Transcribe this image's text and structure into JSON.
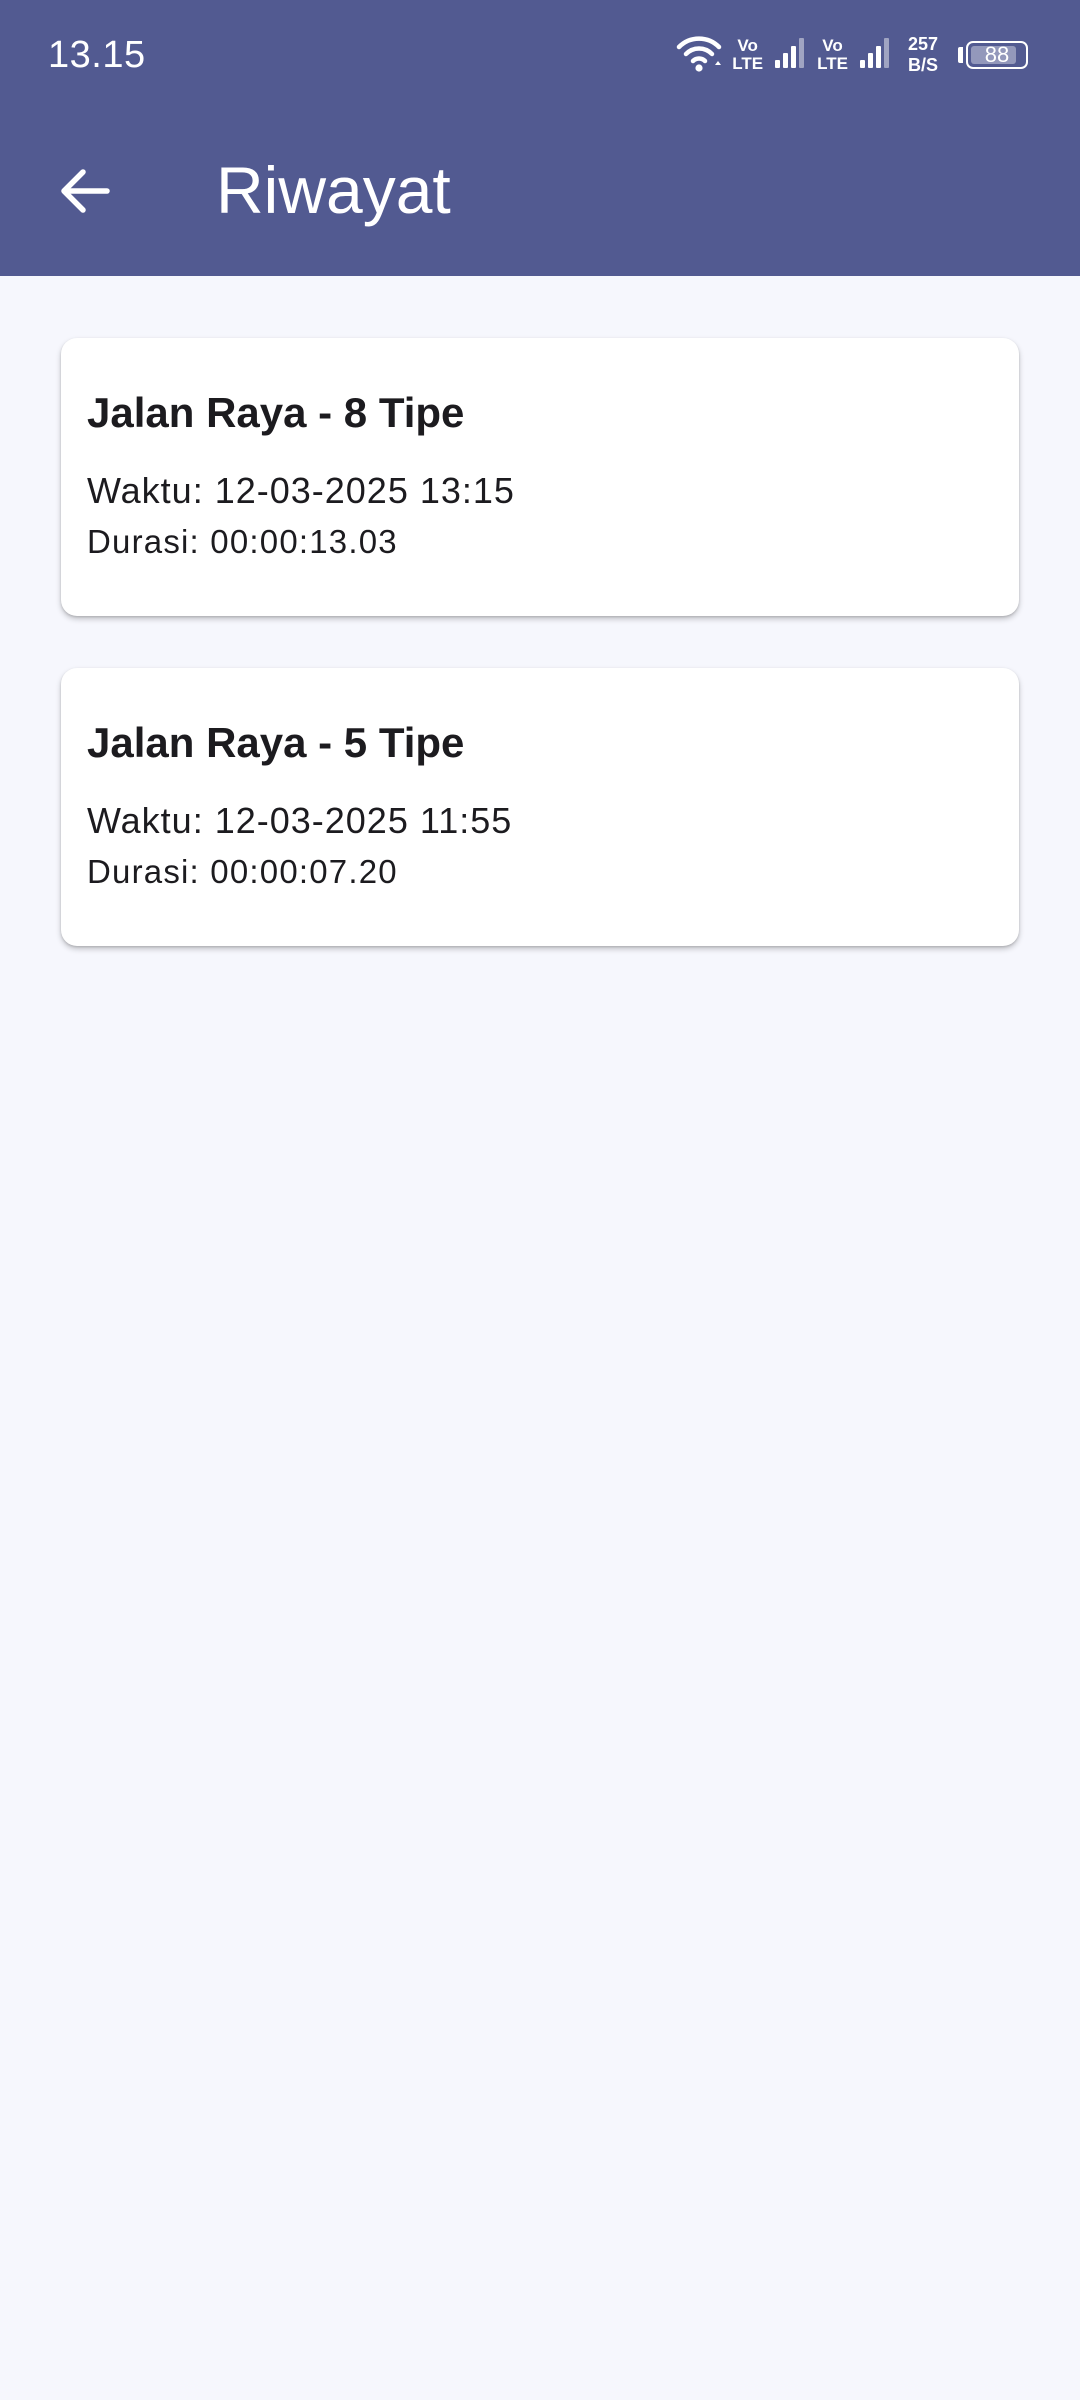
{
  "status_bar": {
    "time": "13.15",
    "volte1_top": "Vo",
    "volte1_bottom": "LTE",
    "volte2_top": "Vo",
    "volte2_bottom": "LTE",
    "speed_value": "257",
    "speed_unit": "B/S",
    "battery_level": "88",
    "battery_fraction": 0.88,
    "icons": [
      "wifi-icon",
      "signal-icon",
      "signal-icon",
      "battery-icon"
    ]
  },
  "toolbar": {
    "back_icon": "arrow-back-icon",
    "title": "Riwayat"
  },
  "history": [
    {
      "title": "Jalan Raya - 8 Tipe",
      "time": "Waktu: 12-03-2025 13:15",
      "duration": "Durasi: 00:00:13.03"
    },
    {
      "title": "Jalan Raya - 5 Tipe",
      "time": "Waktu: 12-03-2025 11:55",
      "duration": "Durasi: 00:00:07.20"
    }
  ],
  "colors": {
    "header": "#525a91",
    "background": "#f6f7fd",
    "card": "#ffffff",
    "text": "#1c1b1f"
  }
}
